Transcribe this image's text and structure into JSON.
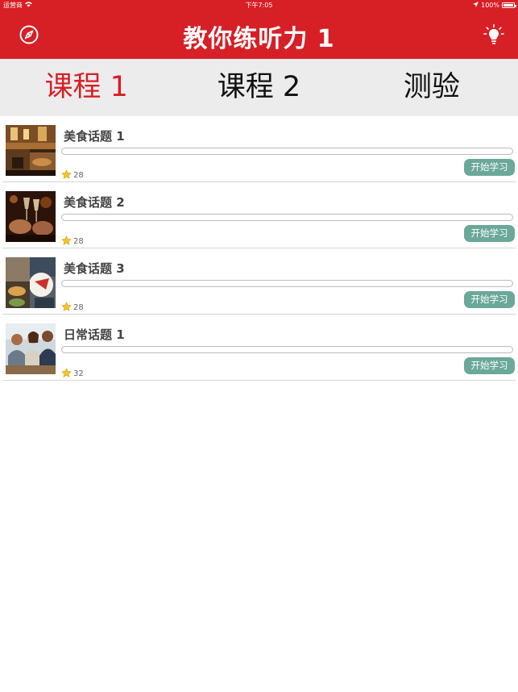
{
  "status_bar": {
    "carrier": "运营商",
    "time": "下午7:05",
    "battery": "100%"
  },
  "header": {
    "title": "教你练听力 1",
    "left_icon": "compass-icon",
    "right_icon": "lightbulb-icon"
  },
  "tabs": [
    {
      "label": "课程 1",
      "active": true
    },
    {
      "label": "课程 2",
      "active": false
    },
    {
      "label": "测验",
      "active": false
    }
  ],
  "lessons": [
    {
      "title": "美食话题 1",
      "count": "28",
      "progress": 0,
      "button": "开始学习",
      "image": "restaurant-interior"
    },
    {
      "title": "美食话题 2",
      "count": "28",
      "progress": 0,
      "button": "开始学习",
      "image": "wine-toast"
    },
    {
      "title": "美食话题 3",
      "count": "28",
      "progress": 0,
      "button": "开始学习",
      "image": "dining-table"
    },
    {
      "title": "日常话题 1",
      "count": "32",
      "progress": 0,
      "button": "开始学习",
      "image": "people-conversation"
    }
  ],
  "colors": {
    "brand_red": "#d71f26",
    "tab_bg": "#ececed",
    "button_teal": "#6aa89a"
  }
}
